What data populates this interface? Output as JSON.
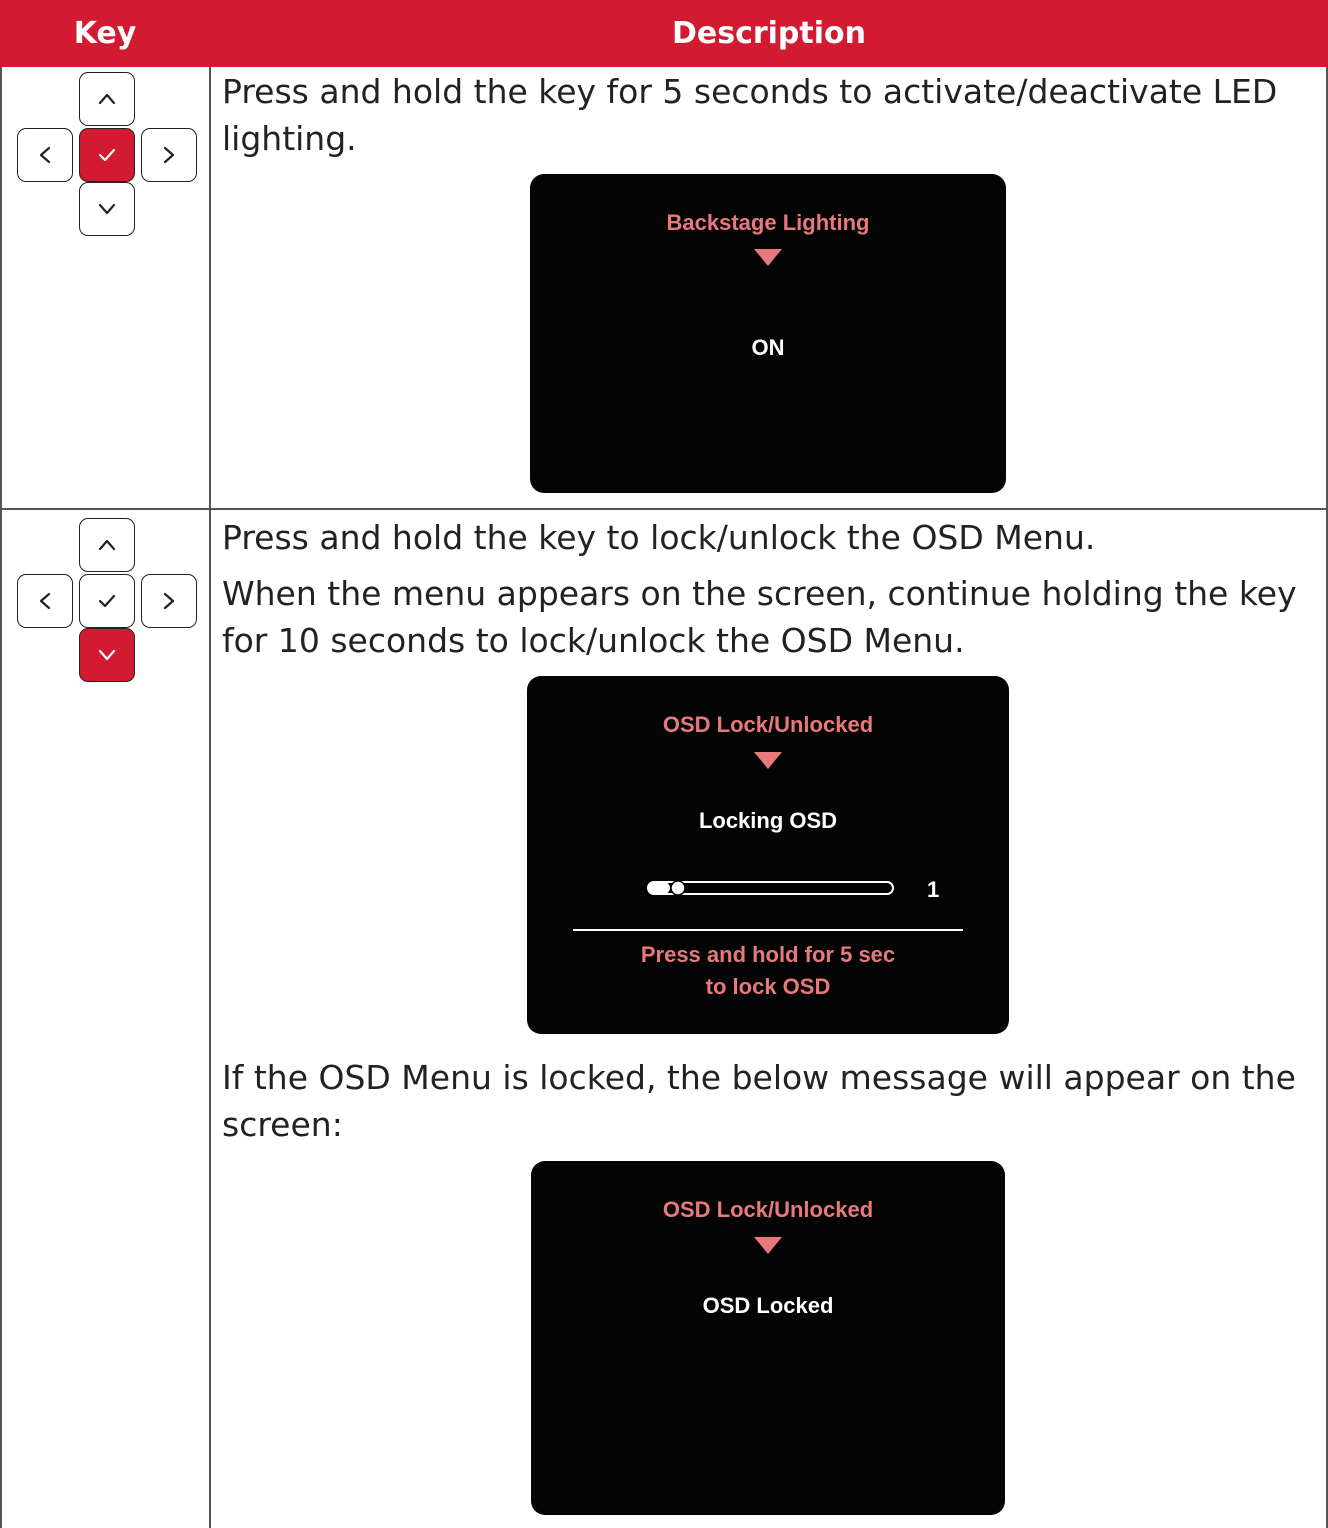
{
  "header": {
    "key": "Key",
    "description": "Description"
  },
  "colors": {
    "accent": "#d21a30",
    "osd_accent": "#e8797b",
    "screen_bg": "#040404"
  },
  "rows": [
    {
      "active_key": "enter",
      "text": [
        "Press and hold the key for 5 seconds to activate/deactivate LED lighting."
      ],
      "screen": {
        "title": "Backstage Lighting",
        "value": "ON"
      }
    },
    {
      "active_key": "down",
      "text_lines": [
        "Press and hold the key to lock/unlock the OSD Menu.",
        "When the menu appears on the screen, continue holding the key for 10 seconds to lock/unlock the OSD Menu."
      ],
      "screen": {
        "title": "OSD Lock/Unlocked",
        "status": "Locking OSD",
        "progress_value": "1",
        "hint_line1": "Press and hold for 5 sec",
        "hint_line2": "to lock OSD"
      },
      "after_text": "If the OSD Menu is locked, the below message will appear on the screen:",
      "screen2": {
        "title": "OSD Lock/Unlocked",
        "status": "OSD Locked"
      }
    }
  ],
  "icons": {
    "up": "chevron-up-icon",
    "down": "chevron-down-icon",
    "left": "chevron-left-icon",
    "right": "chevron-right-icon",
    "enter": "check-icon"
  }
}
